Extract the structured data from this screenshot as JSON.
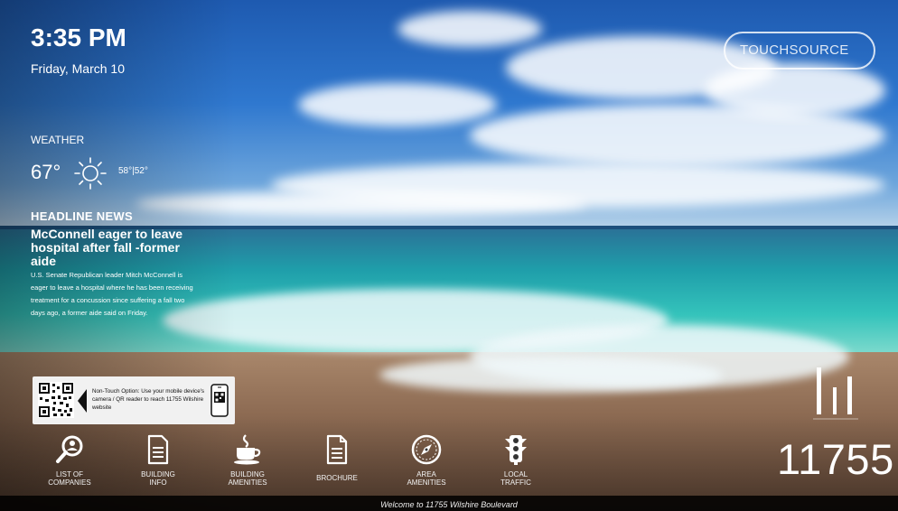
{
  "clock": {
    "time": "3:35 PM",
    "date": "Friday, March 10"
  },
  "weather": {
    "label": "WEATHER",
    "temperature": "67°",
    "icon": "sun-icon",
    "high_low": "58°|52°"
  },
  "news": {
    "label": "HEADLINE NEWS",
    "headline": "McConnell eager to leave hospital after fall -former aide",
    "body": "U.S. Senate Republican leader Mitch McConnell is eager to leave a hospital where he has been receiving treatment for a concussion since suffering a fall two days ago, a former aide said on Friday."
  },
  "qr_panel": {
    "text": "Non-Touch Option: Use your mobile device's camera / QR reader to reach 11755 Wilshire website",
    "icons": [
      "qr-code-icon",
      "arrow-left-icon",
      "phone-qr-icon"
    ]
  },
  "logo": {
    "name": "TOUCHSOURCE"
  },
  "brand": {
    "number": "11755",
    "mark_icon": "building-mark-icon"
  },
  "nav": [
    {
      "label_line1": "LIST OF",
      "label_line2": "COMPANIES",
      "icon": "search-person-icon"
    },
    {
      "label_line1": "BUILDING",
      "label_line2": "INFO",
      "icon": "document-icon"
    },
    {
      "label_line1": "BUILDING",
      "label_line2": "AMENITIES",
      "icon": "coffee-cup-icon"
    },
    {
      "label_line1": "BROCHURE",
      "label_line2": "",
      "icon": "brochure-icon"
    },
    {
      "label_line1": "AREA",
      "label_line2": "AMENITIES",
      "icon": "compass-icon"
    },
    {
      "label_line1": "LOCAL",
      "label_line2": "TRAFFIC",
      "icon": "traffic-light-icon"
    }
  ],
  "footer": {
    "text": "Welcome to 11755 Wilshire Boulevard"
  },
  "colors": {
    "sky": "#2f78cf",
    "sea": "#34c3bb",
    "sand": "#8c6a52",
    "footer_bg": "#000000",
    "text": "#ffffff"
  }
}
